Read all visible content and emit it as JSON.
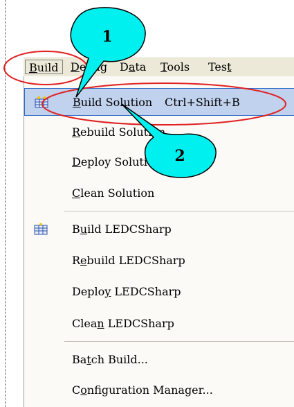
{
  "menubar": {
    "items": [
      {
        "pre": "",
        "ul": "B",
        "post": "uild"
      },
      {
        "pre": "",
        "ul": "D",
        "post": "ebug"
      },
      {
        "pre": "D",
        "ul": "a",
        "post": "ta"
      },
      {
        "pre": "",
        "ul": "T",
        "post": "ools"
      },
      {
        "pre": "Tes",
        "ul": "t",
        "post": ""
      }
    ]
  },
  "dropdown": {
    "items": [
      {
        "pre": "",
        "ul": "B",
        "post": "uild Solution",
        "shortcut": "Ctrl+Shift+B"
      },
      {
        "pre": "",
        "ul": "R",
        "post": "ebuild Solution"
      },
      {
        "pre": "",
        "ul": "D",
        "post": "eploy Solution"
      },
      {
        "pre": "",
        "ul": "C",
        "post": "lean Solution"
      },
      {
        "pre": "B",
        "ul": "u",
        "post": "ild LEDCSharp"
      },
      {
        "pre": "R",
        "ul": "e",
        "post": "build LEDCSharp"
      },
      {
        "pre": "Deplo",
        "ul": "y",
        "post": " LEDCSharp"
      },
      {
        "pre": "Clea",
        "ul": "n",
        "post": " LEDCSharp"
      },
      {
        "pre": "Ba",
        "ul": "t",
        "post": "ch Build..."
      },
      {
        "pre": "C",
        "ul": "o",
        "post": "nfiguration Manager..."
      }
    ]
  },
  "callouts": {
    "one": "1",
    "two": "2"
  },
  "colors": {
    "callout_fill": "#00f0f0",
    "highlight_ring": "#e02020",
    "selection_bg": "#c1d2ee",
    "selection_border": "#316ac5"
  },
  "icons": {
    "build_solution": "build-solution-icon",
    "build_project": "build-project-icon"
  }
}
